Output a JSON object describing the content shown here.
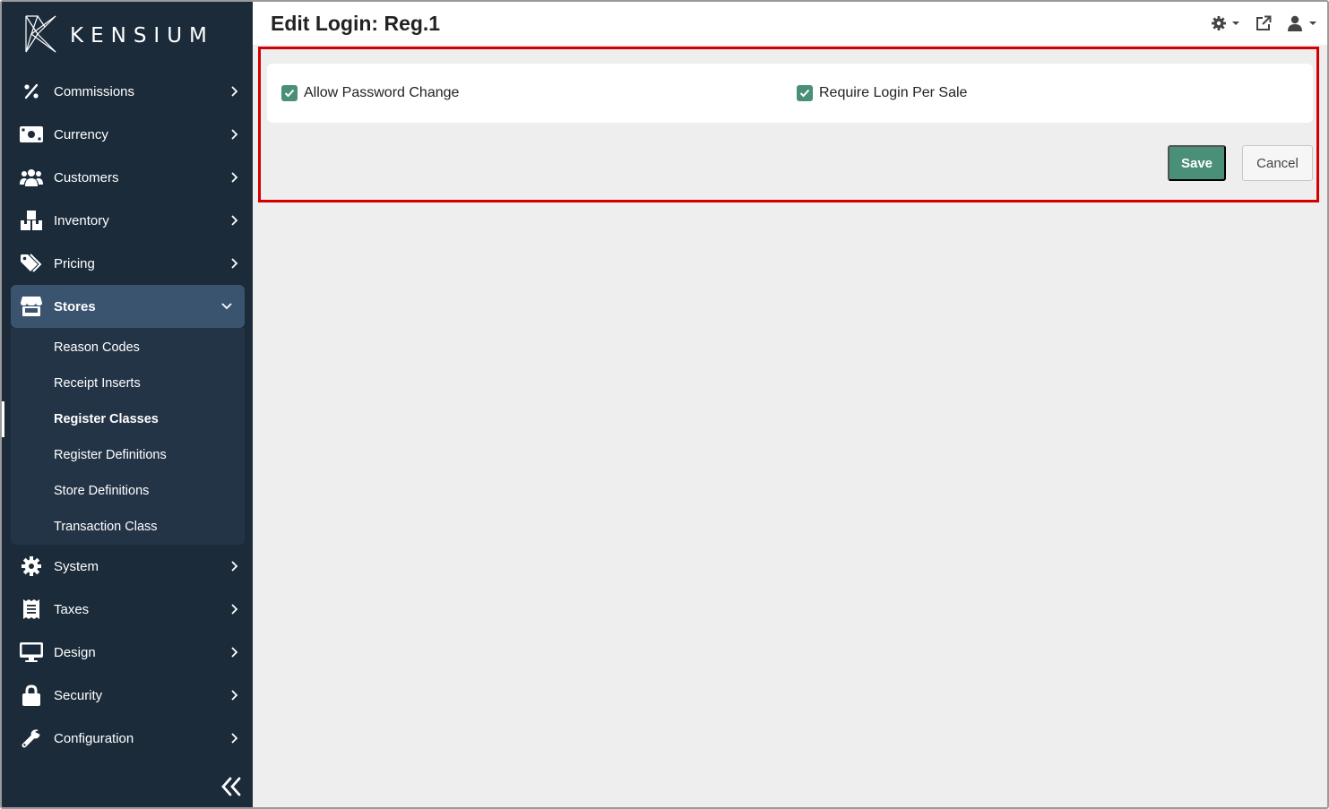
{
  "brand": {
    "name": "KENSIUM"
  },
  "sidebar": {
    "items": [
      {
        "label": "Commissions",
        "icon": "percent-icon"
      },
      {
        "label": "Currency",
        "icon": "money-bill-icon"
      },
      {
        "label": "Customers",
        "icon": "users-icon"
      },
      {
        "label": "Inventory",
        "icon": "boxes-icon"
      },
      {
        "label": "Pricing",
        "icon": "tags-icon"
      },
      {
        "label": "Stores",
        "icon": "store-icon",
        "expanded": true
      },
      {
        "label": "System",
        "icon": "gear-icon"
      },
      {
        "label": "Taxes",
        "icon": "receipt-icon"
      },
      {
        "label": "Design",
        "icon": "monitor-icon"
      },
      {
        "label": "Security",
        "icon": "lock-icon"
      },
      {
        "label": "Configuration",
        "icon": "wrench-icon"
      }
    ],
    "stores_submenu": [
      {
        "label": "Reason Codes"
      },
      {
        "label": "Receipt Inserts"
      },
      {
        "label": "Register Classes",
        "current": true
      },
      {
        "label": "Register Definitions"
      },
      {
        "label": "Store Definitions"
      },
      {
        "label": "Transaction Class"
      }
    ]
  },
  "header": {
    "title": "Edit Login: Reg.1",
    "icons": [
      "settings-dropdown-icon",
      "external-link-icon",
      "user-dropdown-icon"
    ]
  },
  "form": {
    "allow_password_change": {
      "label": "Allow Password Change",
      "checked": true
    },
    "require_login_per_sale": {
      "label": "Require Login Per Sale",
      "checked": true
    }
  },
  "actions": {
    "save_label": "Save",
    "cancel_label": "Cancel"
  },
  "colors": {
    "sidebar_bg": "#1c2b3a",
    "sidebar_active": "#3a5470",
    "accent": "#4a8f78",
    "highlight": "#d40000",
    "content_bg": "#eeeeee"
  }
}
